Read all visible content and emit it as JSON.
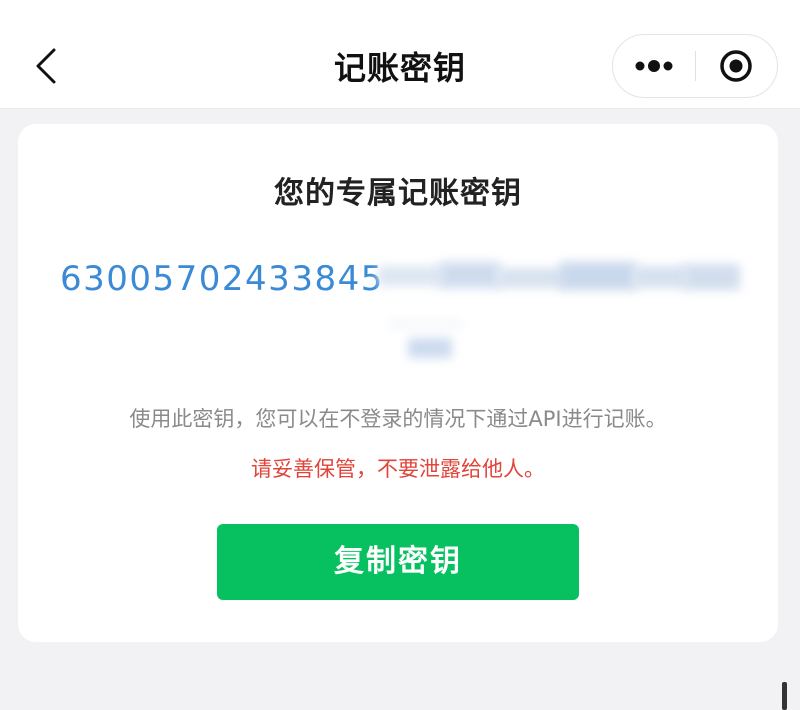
{
  "navbar": {
    "title": "记账密钥",
    "back_icon": "chevron-left-icon",
    "more_icon": "more-dots-icon",
    "close_icon": "target-circle-icon"
  },
  "card": {
    "title": "您的专属记账密钥",
    "key_visible": "63005702433845",
    "key_redacted": true,
    "description": "使用此密钥，您可以在不登录的情况下通过API进行记账。",
    "warning": "请妥善保管，不要泄露给他人。",
    "copy_button_label": "复制密钥"
  },
  "colors": {
    "accent_green": "#07c160",
    "key_blue": "#3a8ad6",
    "warning_red": "#e0443a",
    "muted_gray": "#8a8a8a",
    "page_bg": "#f2f2f4"
  }
}
